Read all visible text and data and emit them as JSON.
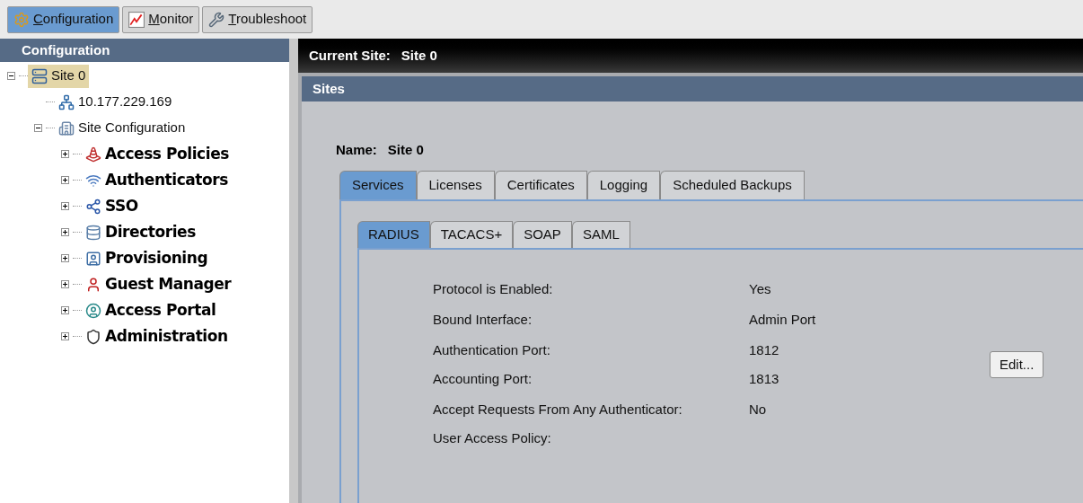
{
  "toolbar": {
    "tabs": [
      {
        "label": "Configuration",
        "selected": true
      },
      {
        "label": "Monitor",
        "selected": false
      },
      {
        "label": "Troubleshoot",
        "selected": false
      }
    ]
  },
  "sidebar": {
    "title": "Configuration",
    "tree": [
      {
        "label": "Site 0",
        "kind": "item",
        "selected": true,
        "expanded": true,
        "children": [
          {
            "label": "10.177.229.169",
            "kind": "item",
            "selected": false
          },
          {
            "label": "Site Configuration",
            "kind": "item",
            "selected": false,
            "expanded": true,
            "children": [
              {
                "label": "Access Policies",
                "kind": "group",
                "selected": false,
                "expanded": false
              },
              {
                "label": "Authenticators",
                "kind": "group",
                "selected": false,
                "expanded": false
              },
              {
                "label": "SSO",
                "kind": "group",
                "selected": false,
                "expanded": false
              },
              {
                "label": "Directories",
                "kind": "group",
                "selected": false,
                "expanded": false
              },
              {
                "label": "Provisioning",
                "kind": "group",
                "selected": false,
                "expanded": false
              },
              {
                "label": "Guest Manager",
                "kind": "group",
                "selected": false,
                "expanded": false
              },
              {
                "label": "Access Portal",
                "kind": "group",
                "selected": false,
                "expanded": false
              },
              {
                "label": "Administration",
                "kind": "group",
                "selected": false,
                "expanded": false
              }
            ]
          }
        ]
      }
    ]
  },
  "current_site": {
    "label": "Current Site:",
    "value": "Site 0"
  },
  "panel": {
    "title": "Sites",
    "name_label": "Name:",
    "name_value": "Site 0",
    "tabs": [
      {
        "label": "Services",
        "selected": true
      },
      {
        "label": "Licenses",
        "selected": false
      },
      {
        "label": "Certificates",
        "selected": false
      },
      {
        "label": "Logging",
        "selected": false
      },
      {
        "label": "Scheduled Backups",
        "selected": false
      }
    ],
    "subtabs": [
      {
        "label": "RADIUS",
        "selected": true
      },
      {
        "label": "TACACS+",
        "selected": false
      },
      {
        "label": "SOAP",
        "selected": false
      },
      {
        "label": "SAML",
        "selected": false
      }
    ],
    "groups": [
      {
        "rows": [
          {
            "label": "Protocol is Enabled:",
            "value": "Yes"
          }
        ]
      },
      {
        "rows": [
          {
            "label": "Bound Interface:",
            "value": "Admin Port"
          }
        ]
      },
      {
        "rows": [
          {
            "label": "Authentication Port:",
            "value": "1812"
          },
          {
            "label": "Accounting Port:",
            "value": "1813"
          }
        ],
        "button": "Edit..."
      },
      {
        "rows": [
          {
            "label": "Accept Requests From Any Authenticator:",
            "value": "No"
          },
          {
            "label": "User Access Policy:"
          }
        ]
      }
    ]
  }
}
